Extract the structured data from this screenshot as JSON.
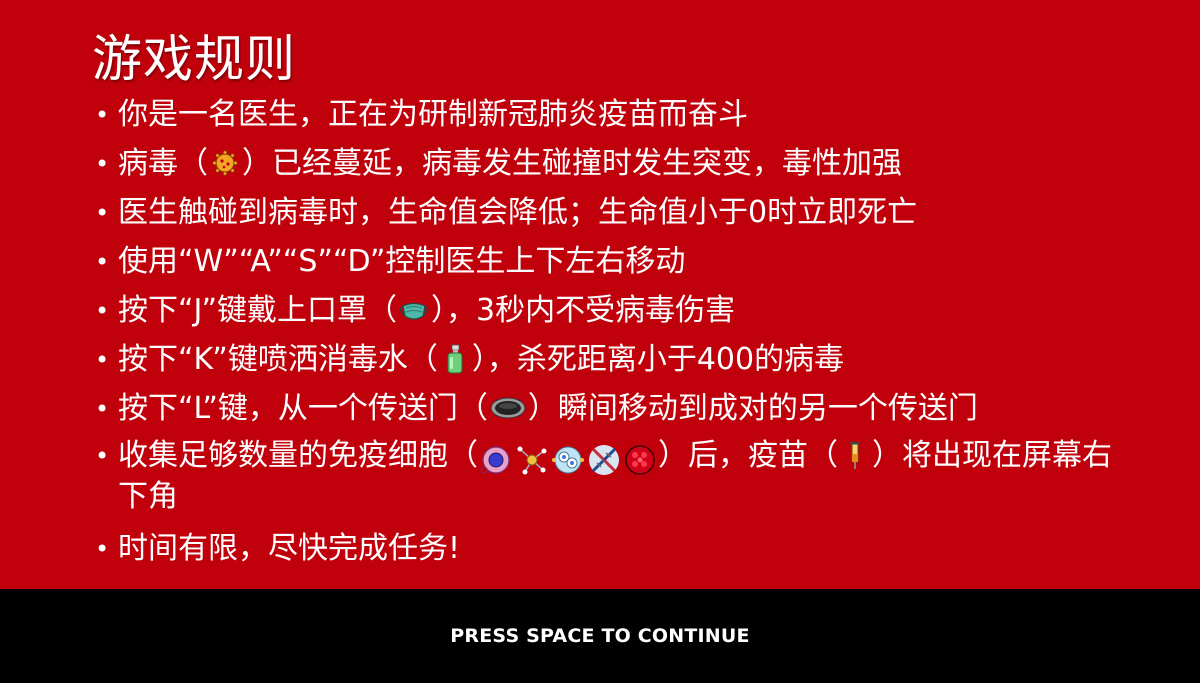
{
  "slide": {
    "title": "游戏规则",
    "bullet": "•",
    "rules": {
      "r1": {
        "text": "你是一名医生，正在为研制新冠肺炎疫苗而奋斗"
      },
      "r2": {
        "a": "病毒（",
        "icon": "virus-icon",
        "b": "）已经蔓延，病毒发生碰撞时发生突变，毒性加强"
      },
      "r3": {
        "text": "医生触碰到病毒时，生命值会降低；生命值小于0时立即死亡"
      },
      "r4": {
        "text": "使用“W”“A”“S”“D”控制医生上下左右移动"
      },
      "r5": {
        "a": "按下“J”键戴上口罩（",
        "icon": "mask-icon",
        "b": "），3秒内不受病毒伤害"
      },
      "r6": {
        "a": "按下“K”键喷洒消毒水（",
        "icon": "spray-bottle-icon",
        "b": "），杀死距离小于400的病毒"
      },
      "r7": {
        "a": "按下“L”键，从一个传送门（",
        "icon": "portal-icon",
        "b": "）瞬间移动到成对的另一个传送门"
      },
      "r8": {
        "a": "收集足够数量的免疫细胞（",
        "icons": [
          "immune-cell-blue-icon",
          "immune-cell-network-icon",
          "immune-cell-cluster-icon",
          "dna-icon",
          "red-cell-icon"
        ],
        "b": "）后，疫苗（",
        "vaccine_icon": "syringe-icon",
        "c": "）将出现在屏幕右下角"
      },
      "r9": {
        "text": "时间有限，尽快完成任务!"
      }
    }
  },
  "footer": {
    "continue_prompt": "PRESS SPACE TO CONTINUE"
  },
  "colors": {
    "background": "#c0000b",
    "text": "#ffffff",
    "footer": "#000000"
  }
}
